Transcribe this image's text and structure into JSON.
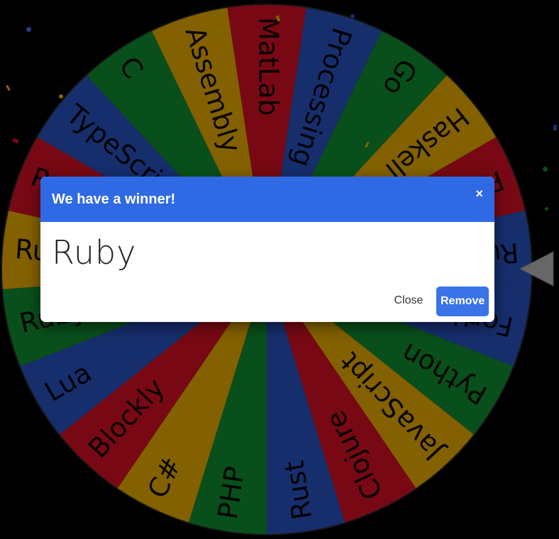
{
  "wheel": {
    "segments": [
      {
        "label": "MatLab",
        "color": "#b80f1f"
      },
      {
        "label": "Processing",
        "color": "#2447a8"
      },
      {
        "label": "Go",
        "color": "#0e7a2a"
      },
      {
        "label": "Haskell",
        "color": "#c99600"
      },
      {
        "label": "Ruby",
        "color": "#b80f1f"
      },
      {
        "label": "Ruby",
        "color": "#2447a8"
      },
      {
        "label": "Forth",
        "color": "#2447a8"
      },
      {
        "label": "Python",
        "color": "#0e7a2a"
      },
      {
        "label": "JavaScript",
        "color": "#c99600"
      },
      {
        "label": "Clojure",
        "color": "#b80f1f"
      },
      {
        "label": "Rust",
        "color": "#2447a8"
      },
      {
        "label": "PHP",
        "color": "#0e7a2a"
      },
      {
        "label": "C#",
        "color": "#c99600"
      },
      {
        "label": "Blockly",
        "color": "#b80f1f"
      },
      {
        "label": "Lua",
        "color": "#2447a8"
      },
      {
        "label": "Ruby",
        "color": "#0e7a2a"
      },
      {
        "label": "Ruby",
        "color": "#c99600"
      },
      {
        "label": "Ruby",
        "color": "#b80f1f"
      },
      {
        "label": "TypeScript",
        "color": "#2447a8"
      },
      {
        "label": "C",
        "color": "#0e7a2a"
      },
      {
        "label": "Assembly",
        "color": "#c99600"
      }
    ],
    "pointer_color": "#9e9e9e"
  },
  "dialog": {
    "title": "We have a winner!",
    "close_icon": "×",
    "winner": "Ruby",
    "close_label": "Close",
    "remove_label": "Remove",
    "header_color": "#3069e4",
    "button_color": "#3a73e8"
  }
}
